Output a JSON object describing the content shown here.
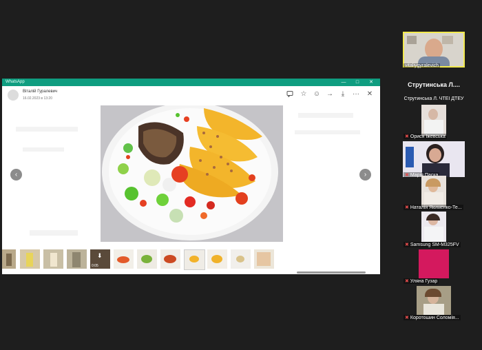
{
  "window": {
    "title": "WhatsApp",
    "minimize": "—",
    "maximize": "□",
    "close": "✕"
  },
  "viewer": {
    "sender_name": "Віталій Гуралевич",
    "sender_date": "16.02.2023 в 13:20",
    "toolbar": [
      "comment-icon",
      "star-icon",
      "smile-icon",
      "forward-icon",
      "download-icon",
      "more-icon",
      "close-icon"
    ],
    "more_label": "···",
    "close_label": "✕",
    "prev_label": "‹",
    "next_label": "›",
    "video_duration": "0:05"
  },
  "participants": [
    {
      "name": "vitaliygyralevich",
      "muted": false,
      "highlight": true
    },
    {
      "name": "Струтинська Л....",
      "sub": "Струтинська Л. ЧТЕІ ДТЕУ",
      "muted": false
    },
    {
      "name": "Орися Іжевська",
      "muted": true
    },
    {
      "name": "Марія Паска",
      "muted": true
    },
    {
      "name": "Наталія Якименко-Те...",
      "muted": true
    },
    {
      "name": "Samsung SM-M325FV",
      "muted": true
    },
    {
      "name": "Уляна Гузар",
      "muted": true
    },
    {
      "name": "Коротошин Соломія...",
      "muted": true
    }
  ],
  "colors": {
    "titlebar": "#0f9d80",
    "background": "#1e1e1e",
    "active_speaker": "#f2e94e",
    "muted_mic": "#e24b4b"
  }
}
